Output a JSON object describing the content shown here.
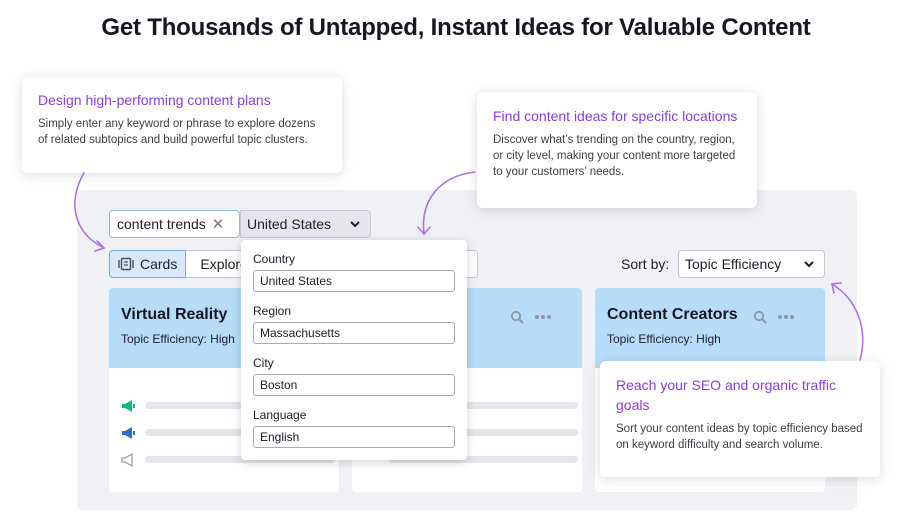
{
  "headline": "Get Thousands of Untapped, Instant Ideas for Valuable Content",
  "search": {
    "keyword": "content trends",
    "clear_icon": "close-icon",
    "location": "United States"
  },
  "view_toggle": {
    "cards_label": "Cards",
    "explorer_label": "Explorer"
  },
  "sort": {
    "label": "Sort by:",
    "value": "Topic Efficiency"
  },
  "cards": [
    {
      "title": "Virtual Reality",
      "efficiency": "Topic Efficiency: High"
    },
    {
      "title": "",
      "efficiency": ""
    },
    {
      "title": "Content Creators",
      "efficiency": "Topic Efficiency: High"
    }
  ],
  "location_dropdown": {
    "country_label": "Country",
    "country_value": "United States",
    "region_label": "Region",
    "region_value": "Massachusetts",
    "city_label": "City",
    "city_value": "Boston",
    "language_label": "Language",
    "language_value": "English"
  },
  "callouts": {
    "plans": {
      "title": "Design high-performing content plans",
      "body": "Simply enter any keyword or phrase to explore dozens of related subtopics and build powerful topic clusters."
    },
    "locations": {
      "title": "Find content ideas for specific locations",
      "body": "Discover what’s trending on the country, region, or city level, making your content more targeted to your customers’ needs."
    },
    "seo": {
      "title": "Reach your SEO and organic traffic goals",
      "body": "Sort your content ideas by topic efficiency based on keyword difficulty and search volume."
    }
  },
  "colors": {
    "accent_purple": "#8b3cdb",
    "card_header": "#b7dcf8",
    "megaphone_green": "#10b77f",
    "megaphone_blue": "#2c6ecb",
    "megaphone_gray": "#9aa0ab"
  }
}
